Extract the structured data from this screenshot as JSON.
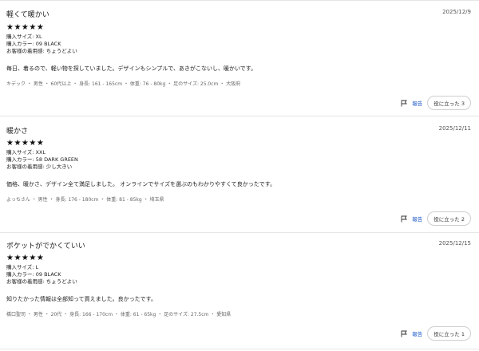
{
  "reviews": [
    {
      "title": "軽くて暖かい",
      "date": "2025/12/9",
      "stars": "★★★★★",
      "size": "購入サイズ: XL",
      "color": "購入カラー: 09 BLACK",
      "fit": "お客様の着用感: ちょうどよい",
      "body": "毎日、着るので、軽い物を探していました。デザインもシンプルで、あきがこないし、暖かいです。",
      "reviewer": "キデック ・ 男性 ・ 60代以上 ・ 身長: 161 - 165cm ・ 体重: 76 - 80kg ・ 足のサイズ: 25.0cm ・ 大阪府",
      "report_label": "報告",
      "helpful_label": "役に立った 3"
    },
    {
      "title": "暖かさ",
      "date": "2025/12/11",
      "stars": "★★★★★",
      "size": "購入サイズ: XXL",
      "color": "購入カラー: 58 DARK GREEN",
      "fit": "お客様の着用感: 少し大きい",
      "body": "価格、暖かさ、デザイン全て満足しました。 オンラインでサイズを選ぶのもわかりやすくて良かったです。",
      "reviewer": "よっちさん ・ 男性 ・ 身長: 176 - 180cm ・ 体重: 81 - 85kg ・ 埼玉県",
      "report_label": "報告",
      "helpful_label": "役に立った 2"
    },
    {
      "title": "ポケットがでかくていい",
      "date": "2025/12/15",
      "stars": "★★★★★",
      "size": "購入サイズ: L",
      "color": "購入カラー: 09 BLACK",
      "fit": "お客様の着用感: ちょうどよい",
      "body": "知りたかった情報は全部知って買えました。良かったです。",
      "reviewer": "橋口聖司 ・ 男性 ・ 20代 ・ 身長: 166 - 170cm ・ 体重: 61 - 65kg ・ 足のサイズ: 27.5cm ・ 愛知県",
      "report_label": "報告",
      "helpful_label": "役に立った 1"
    }
  ]
}
